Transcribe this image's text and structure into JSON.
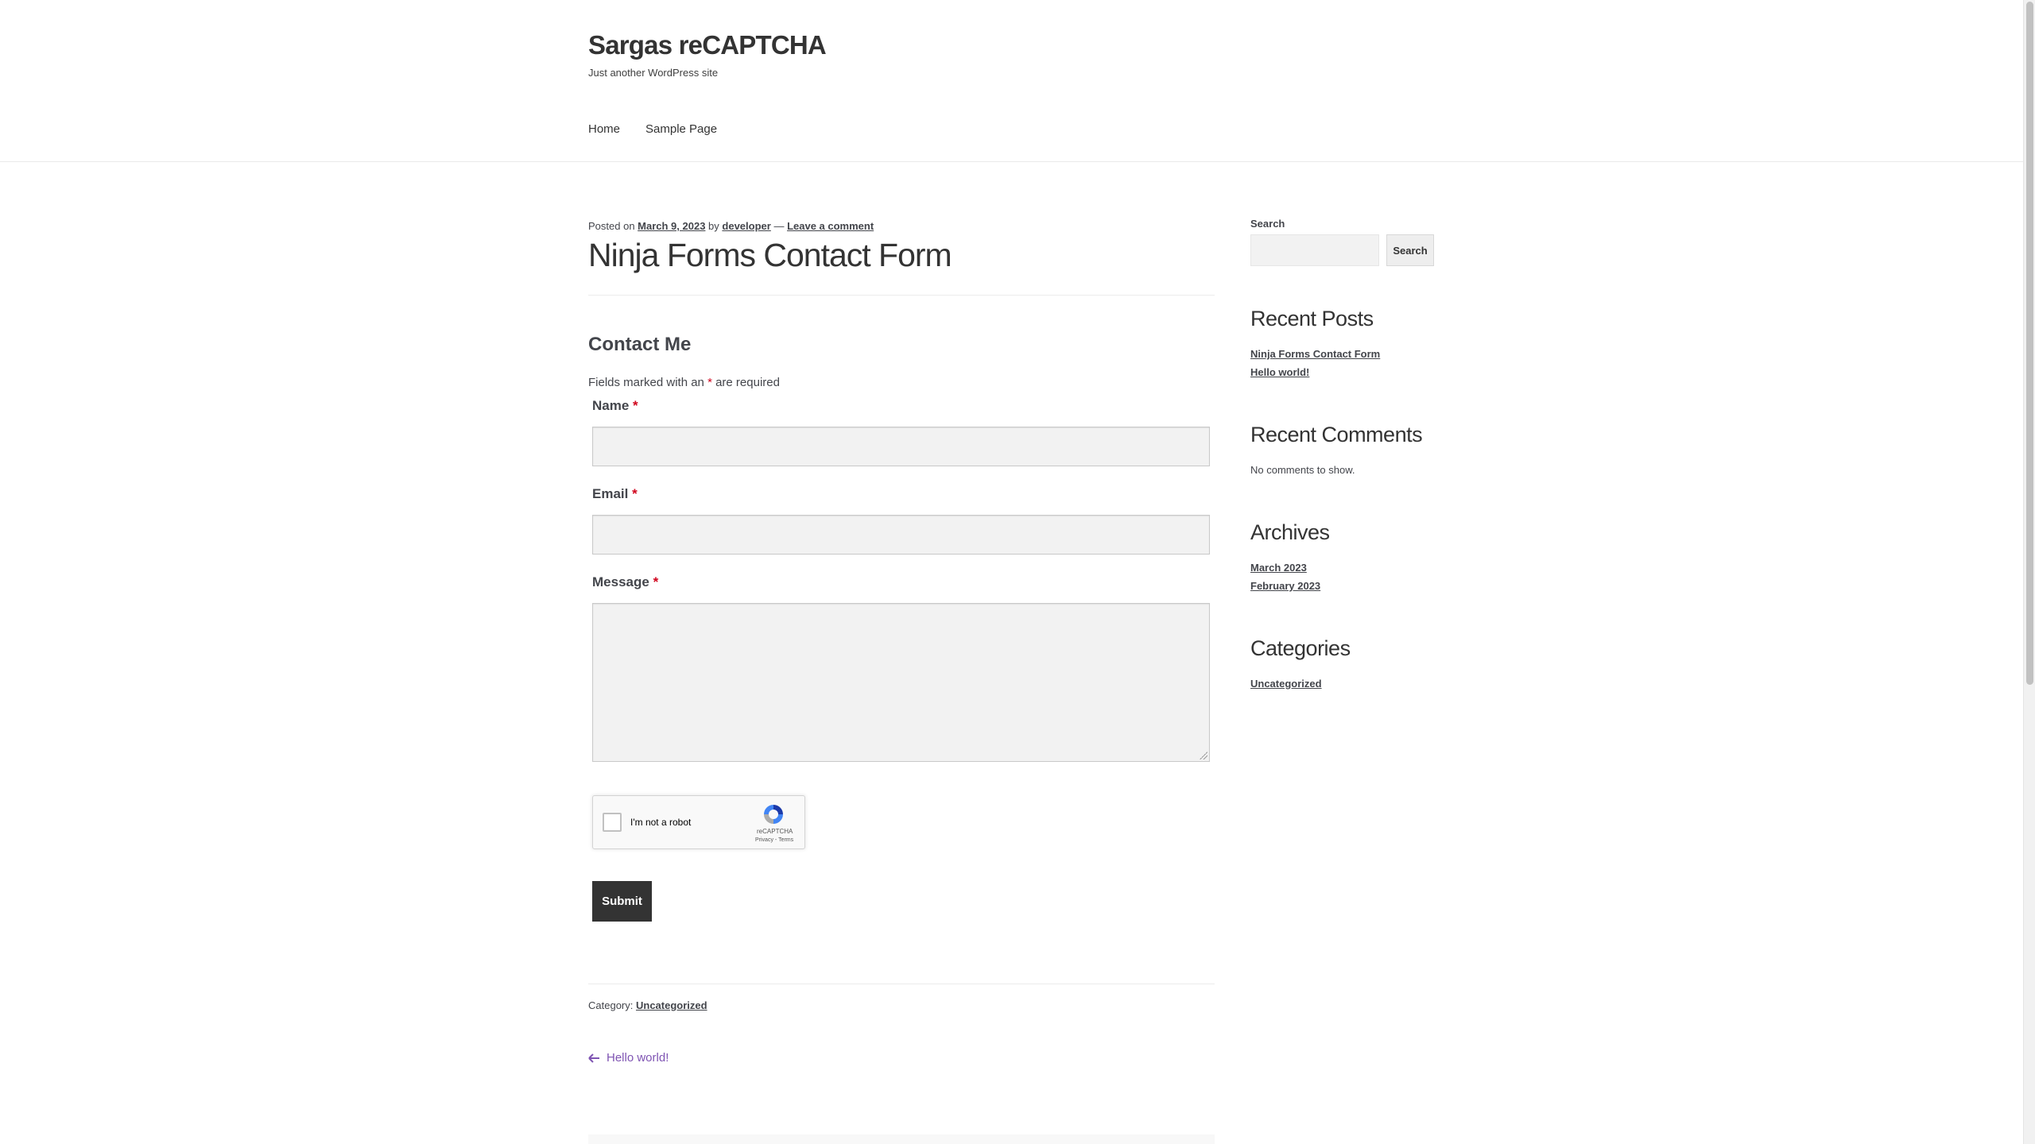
{
  "site": {
    "title": "Sargas reCAPTCHA",
    "tagline": "Just another WordPress site"
  },
  "nav": {
    "items": [
      {
        "label": "Home"
      },
      {
        "label": "Sample Page"
      }
    ]
  },
  "post": {
    "meta_prefix": "Posted on ",
    "date": "March 9, 2023",
    "by": " by ",
    "author": "developer",
    "dash": " — ",
    "comment_link": "Leave a comment",
    "title": "Ninja Forms Contact Form",
    "category_prefix": "Category: ",
    "category": "Uncategorized",
    "prev_post": "Hello world!"
  },
  "form": {
    "title": "Contact Me",
    "required_note_before": "Fields marked with an ",
    "required_note_asterisk": "*",
    "required_note_after": " are required",
    "fields": [
      {
        "label": "Name",
        "required": "*",
        "value": ""
      },
      {
        "label": "Email",
        "required": "*",
        "value": ""
      },
      {
        "label": "Message",
        "required": "*",
        "value": ""
      }
    ],
    "recaptcha": {
      "label": "I'm not a robot",
      "brand": "reCAPTCHA",
      "privacy": "Privacy",
      "separator": " - ",
      "terms": "Terms"
    },
    "submit_label": "Submit"
  },
  "sidebar": {
    "search": {
      "label": "Search",
      "placeholder": "",
      "button_label": "Search"
    },
    "recent_posts": {
      "title": "Recent Posts",
      "items": [
        "Ninja Forms Contact Form",
        "Hello world!"
      ]
    },
    "recent_comments": {
      "title": "Recent Comments",
      "empty_text": "No comments to show."
    },
    "archives": {
      "title": "Archives",
      "items": [
        "March 2023",
        "February 2023"
      ]
    },
    "categories": {
      "title": "Categories",
      "items": [
        "Uncategorized"
      ]
    }
  },
  "colors": {
    "accent_link": "#7f54b3",
    "required": "#d0021b",
    "button_bg": "#333333"
  }
}
